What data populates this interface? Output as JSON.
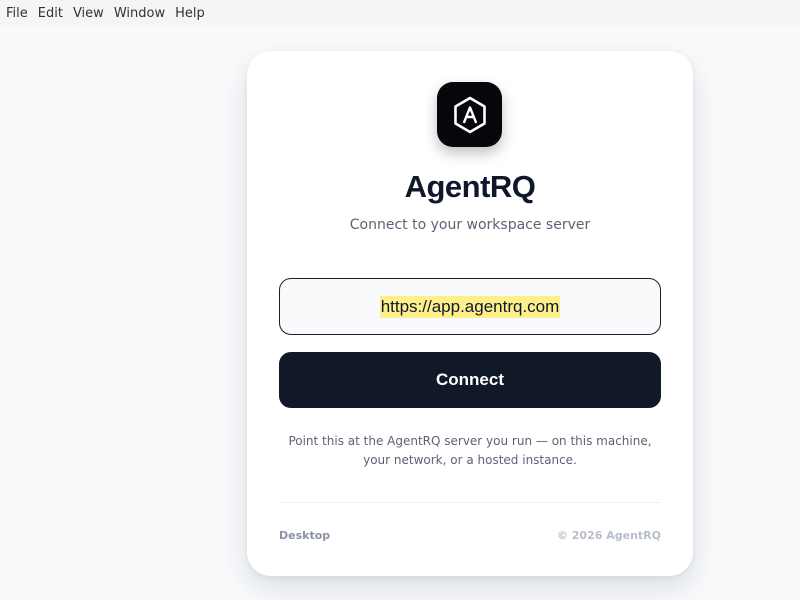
{
  "menubar": {
    "items": [
      "File",
      "Edit",
      "View",
      "Window",
      "Help"
    ]
  },
  "login": {
    "logo_icon": "agentrq-hexagon-A-icon",
    "title": "AgentRQ",
    "subtitle": "Connect to your workspace server",
    "server_url": {
      "value": "https://app.agentrq.com"
    },
    "connect_label": "Connect",
    "hint": "Point this at the AgentRQ server you run — on this machine, your network, or a hosted instance.",
    "footer_left": "Desktop",
    "footer_right": "© 2026 AgentRQ"
  },
  "colors": {
    "accent": "#111827",
    "background": "#f8fafc",
    "card": "#ffffff",
    "selection_highlight": "#fdf08a"
  }
}
